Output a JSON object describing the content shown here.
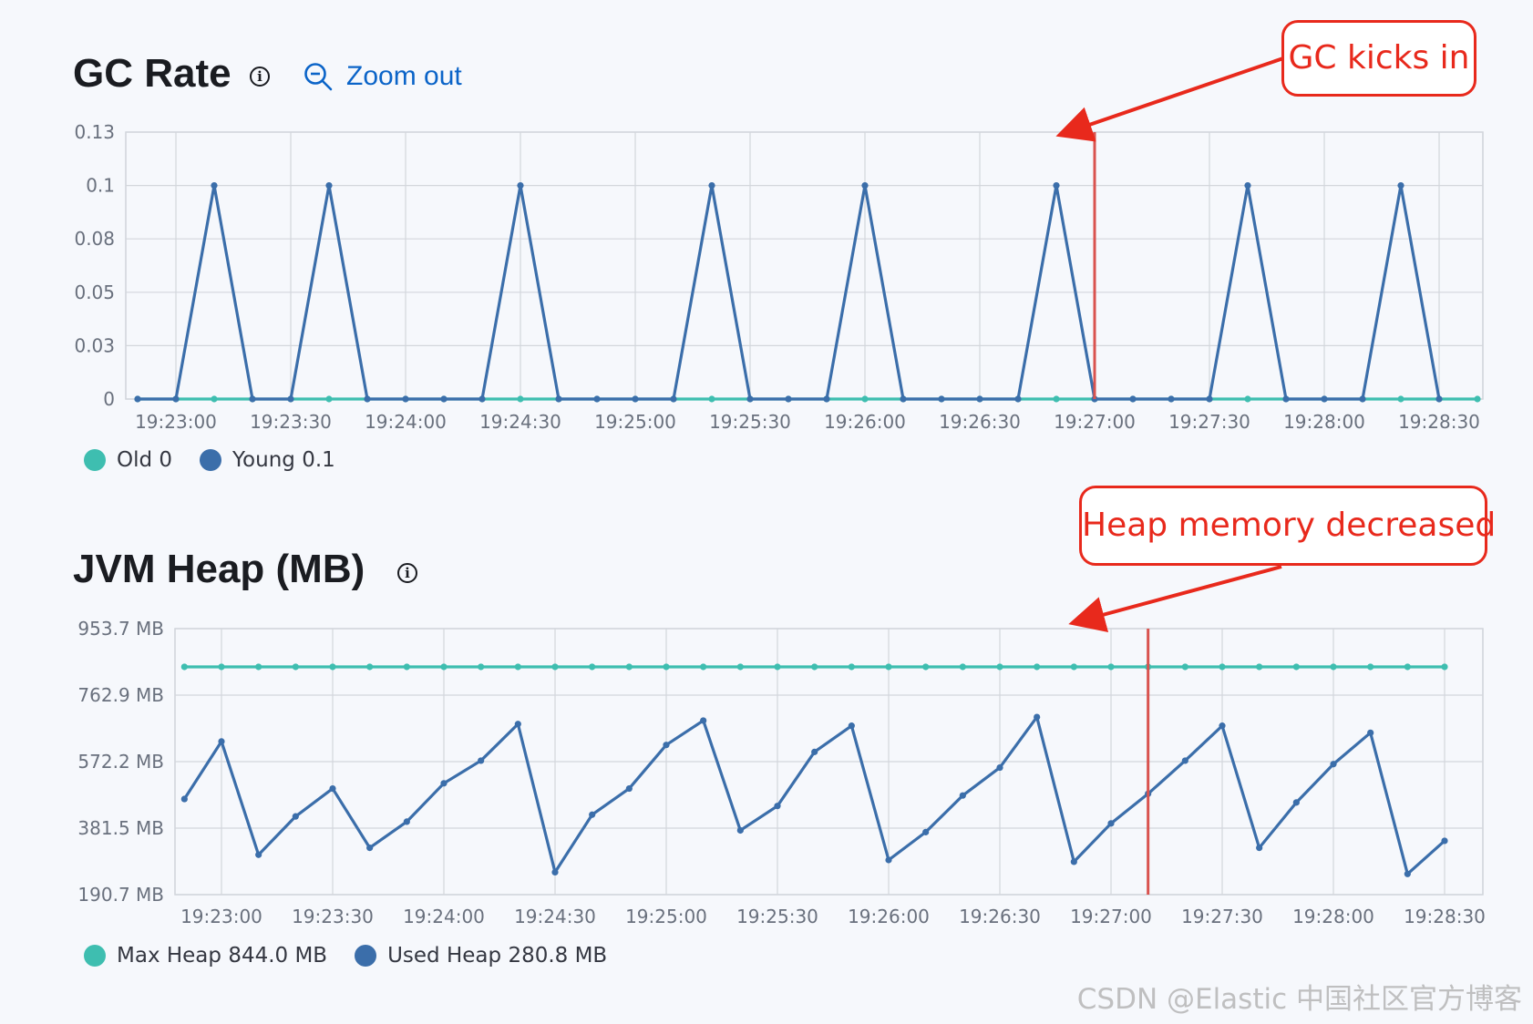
{
  "gc_panel": {
    "title": "GC Rate",
    "zoom_out_label": "Zoom out",
    "legend": [
      {
        "label": "Old",
        "value": "0",
        "color": "#3ebeb0"
      },
      {
        "label": "Young",
        "value": "0.1",
        "color": "#3b6eaa"
      }
    ],
    "annotation": "GC kicks in"
  },
  "heap_panel": {
    "title": "JVM Heap (MB)",
    "legend": [
      {
        "label": "Max Heap",
        "value": "844.0 MB",
        "color": "#3ebeb0"
      },
      {
        "label": "Used Heap",
        "value": "280.8 MB",
        "color": "#3b6eaa"
      }
    ],
    "annotation": "Heap memory decreased"
  },
  "watermark": "CSDN @Elastic 中国社区官方博客",
  "chart_data": [
    {
      "type": "line",
      "title": "GC Rate",
      "x_tick_labels": [
        "19:23:00",
        "19:23:30",
        "19:24:00",
        "19:24:30",
        "19:25:00",
        "19:25:30",
        "19:26:00",
        "19:26:30",
        "19:27:00",
        "19:27:30",
        "19:28:00",
        "19:28:30"
      ],
      "y_tick_labels": [
        "0",
        "0.03",
        "0.05",
        "0.08",
        "0.1",
        "0.13"
      ],
      "ylim": [
        0,
        0.125
      ],
      "x_range_seconds": [
        -10,
        340
      ],
      "grid": true,
      "legend_position": "bottom-left",
      "series": [
        {
          "name": "Old",
          "color": "#3ebeb0",
          "x_seconds": [
            -10,
            0,
            10,
            20,
            30,
            40,
            50,
            60,
            70,
            80,
            90,
            100,
            110,
            120,
            130,
            140,
            150,
            160,
            170,
            180,
            190,
            200,
            210,
            220,
            230,
            240,
            250,
            260,
            270,
            280,
            290,
            300,
            310,
            320,
            330,
            340
          ],
          "values": [
            0,
            0,
            0,
            0,
            0,
            0,
            0,
            0,
            0,
            0,
            0,
            0,
            0,
            0,
            0,
            0,
            0,
            0,
            0,
            0,
            0,
            0,
            0,
            0,
            0,
            0,
            0,
            0,
            0,
            0,
            0,
            0,
            0,
            0,
            0,
            0
          ]
        },
        {
          "name": "Young",
          "color": "#3b6eaa",
          "x_seconds": [
            -10,
            0,
            10,
            20,
            30,
            40,
            50,
            60,
            70,
            80,
            90,
            100,
            110,
            120,
            130,
            140,
            150,
            160,
            170,
            180,
            190,
            200,
            210,
            220,
            230,
            240,
            250,
            260,
            270,
            280,
            290,
            300,
            310,
            320,
            330,
            340
          ],
          "values": [
            0,
            0,
            0.1,
            0,
            0,
            0.1,
            0,
            0,
            0,
            0,
            0.1,
            0,
            0,
            0,
            0,
            0.1,
            0,
            0,
            0,
            0.1,
            0,
            0,
            0,
            0,
            0.1,
            0,
            0,
            0,
            0,
            0.1,
            0,
            0,
            0,
            0.1,
            0
          ]
        }
      ],
      "marker_at_seconds": 240,
      "marker_label": "GC kicks in"
    },
    {
      "type": "line",
      "title": "JVM Heap (MB)",
      "x_tick_labels": [
        "19:23:00",
        "19:23:30",
        "19:24:00",
        "19:24:30",
        "19:25:00",
        "19:25:30",
        "19:26:00",
        "19:26:30",
        "19:27:00",
        "19:27:30",
        "19:28:00",
        "19:28:30"
      ],
      "y_tick_labels": [
        "190.7 MB",
        "381.5 MB",
        "572.2 MB",
        "762.9 MB",
        "953.7 MB"
      ],
      "ylim": [
        190.7,
        953.7
      ],
      "x_range_seconds": [
        -10,
        340
      ],
      "grid": true,
      "legend_position": "bottom-left",
      "series": [
        {
          "name": "Max Heap",
          "color": "#3ebeb0",
          "x_seconds": [
            -10,
            0,
            10,
            20,
            30,
            40,
            50,
            60,
            70,
            80,
            90,
            100,
            110,
            120,
            130,
            140,
            150,
            160,
            170,
            180,
            190,
            200,
            210,
            220,
            230,
            240,
            250,
            260,
            270,
            280,
            290,
            300,
            310,
            320,
            330
          ],
          "values": [
            844,
            844,
            844,
            844,
            844,
            844,
            844,
            844,
            844,
            844,
            844,
            844,
            844,
            844,
            844,
            844,
            844,
            844,
            844,
            844,
            844,
            844,
            844,
            844,
            844,
            844,
            844,
            844,
            844,
            844,
            844,
            844,
            844,
            844,
            844
          ]
        },
        {
          "name": "Used Heap",
          "color": "#3b6eaa",
          "x_seconds": [
            -10,
            0,
            10,
            20,
            30,
            40,
            50,
            60,
            70,
            80,
            90,
            100,
            110,
            120,
            130,
            140,
            150,
            160,
            170,
            180,
            190,
            200,
            210,
            220,
            230,
            240,
            250,
            260,
            270,
            280,
            290,
            300,
            310,
            320,
            330
          ],
          "values": [
            465,
            630,
            305,
            415,
            495,
            325,
            400,
            510,
            575,
            680,
            255,
            420,
            495,
            620,
            690,
            375,
            445,
            600,
            675,
            290,
            370,
            475,
            555,
            700,
            285,
            395,
            480,
            575,
            675,
            325,
            455,
            565,
            655,
            250,
            345
          ]
        }
      ],
      "marker_at_seconds": 250,
      "marker_label": "Heap memory decreased"
    }
  ]
}
